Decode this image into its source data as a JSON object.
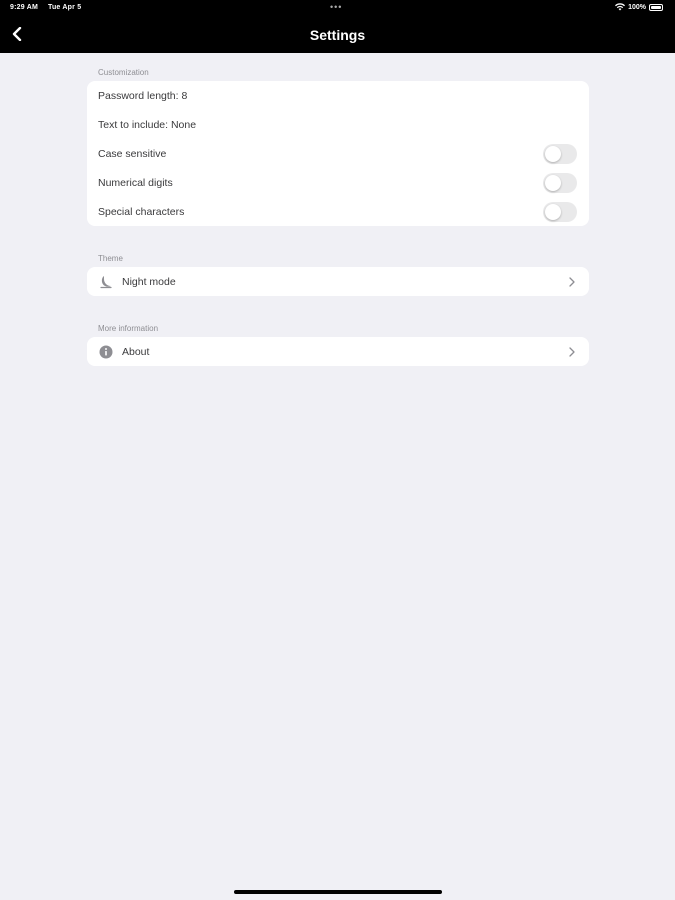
{
  "status_bar": {
    "time": "9:29 AM",
    "date": "Tue Apr 5",
    "battery": "100%",
    "battery_level": 1.0
  },
  "header": {
    "title": "Settings"
  },
  "customization": {
    "section_label": "Customization",
    "password_length": "Password length: 8",
    "text_to_include": "Text to include: None",
    "toggles": [
      {
        "label": "Case sensitive",
        "on": false
      },
      {
        "label": "Numerical digits",
        "on": false
      },
      {
        "label": "Special characters",
        "on": false
      }
    ]
  },
  "theme": {
    "section_label": "Theme",
    "night_mode_label": "Night mode",
    "icon": "moon-icon"
  },
  "more_info": {
    "section_label": "More information",
    "about_label": "About",
    "icon": "info-icon"
  },
  "colors": {
    "background": "#f0f0f5",
    "header": "#000000",
    "toggle_off": "#e9e9ea"
  }
}
